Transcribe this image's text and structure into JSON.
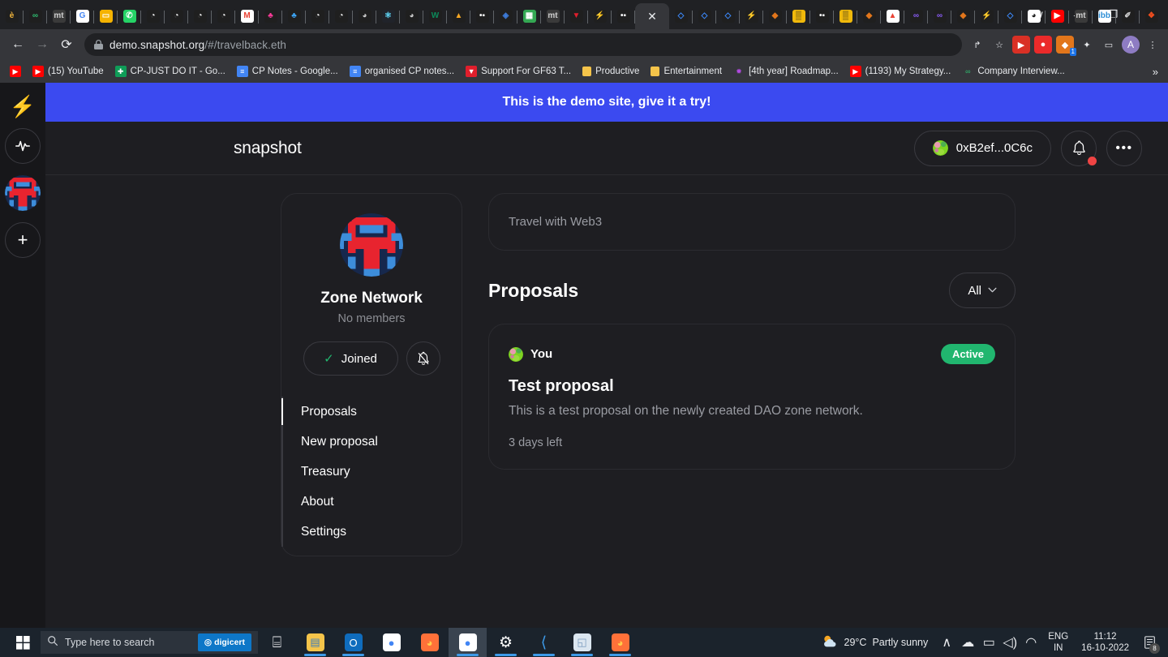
{
  "browser": {
    "tabs": [
      {
        "icon": "python-icon",
        "glyph": "è",
        "bg": "#1f1f1f",
        "fg": "#f5b83d"
      },
      {
        "icon": "link-icon",
        "glyph": "∞",
        "bg": "#1f1f1f",
        "fg": "#2fbf71"
      },
      {
        "icon": "mt-icon",
        "glyph": "mt",
        "bg": "#3a3a3a",
        "fg": "#d0d0d0"
      },
      {
        "icon": "google-icon",
        "glyph": "G",
        "bg": "#ffffff",
        "fg": "#4285f4"
      },
      {
        "icon": "note-icon",
        "glyph": "▭",
        "bg": "#f5b301",
        "fg": "#ffffff"
      },
      {
        "icon": "whatsapp-icon",
        "glyph": "✆",
        "bg": "#25d366",
        "fg": "#ffffff"
      },
      {
        "icon": "github-icon",
        "glyph": "◔",
        "bg": "#1f1f1f",
        "fg": "#ffffff"
      },
      {
        "icon": "github-icon",
        "glyph": "◔",
        "bg": "#1f1f1f",
        "fg": "#ffffff"
      },
      {
        "icon": "github-icon",
        "glyph": "◔",
        "bg": "#1f1f1f",
        "fg": "#ffffff"
      },
      {
        "icon": "github-icon",
        "glyph": "◔",
        "bg": "#1f1f1f",
        "fg": "#ffffff"
      },
      {
        "icon": "gmail-icon",
        "glyph": "M",
        "bg": "#ffffff",
        "fg": "#ea4335"
      },
      {
        "icon": "figma-icon",
        "glyph": "♣",
        "bg": "#1f1f1f",
        "fg": "#ff3b9a"
      },
      {
        "icon": "colorful-icon",
        "glyph": "♣",
        "bg": "#1f1f1f",
        "fg": "#3da5f5"
      },
      {
        "icon": "github-icon",
        "glyph": "◔",
        "bg": "#1f1f1f",
        "fg": "#ffffff"
      },
      {
        "icon": "github-icon",
        "glyph": "◔",
        "bg": "#1f1f1f",
        "fg": "#ffffff"
      },
      {
        "icon": "globe-icon",
        "glyph": "◕",
        "bg": "#1f1f1f",
        "fg": "#c6c6c6"
      },
      {
        "icon": "react-icon",
        "glyph": "⚛",
        "bg": "#20232a",
        "fg": "#61dafb"
      },
      {
        "icon": "globe-icon",
        "glyph": "◕",
        "bg": "#1f1f1f",
        "fg": "#c6c6c6"
      },
      {
        "icon": "w-icon",
        "glyph": "W",
        "bg": "#1f1f1f",
        "fg": "#0c8a5a"
      },
      {
        "icon": "tent-icon",
        "glyph": "▲",
        "bg": "#1f1f1f",
        "fg": "#f5a623"
      },
      {
        "icon": "dumbbell-icon",
        "glyph": "•▪",
        "bg": "#1f1f1f",
        "fg": "#ffffff"
      },
      {
        "icon": "eye-icon",
        "glyph": "◈",
        "bg": "#1f1f1f",
        "fg": "#3d7bd8"
      },
      {
        "icon": "sheet-icon",
        "glyph": "▦",
        "bg": "#34a853",
        "fg": "#ffffff"
      },
      {
        "icon": "mt-icon",
        "glyph": "mt",
        "bg": "#3a3a3a",
        "fg": "#d0d0d0"
      },
      {
        "icon": "tether-icon",
        "glyph": "▼",
        "bg": "#1f1f1f",
        "fg": "#e01e2c"
      },
      {
        "icon": "bolt-icon",
        "glyph": "⚡",
        "bg": "#1f1f1f",
        "fg": "#f5b301"
      },
      {
        "icon": "dumbbell-icon",
        "glyph": "•▪",
        "bg": "#1f1f1f",
        "fg": "#ffffff"
      },
      {
        "icon": "active-tab-close-icon",
        "glyph": "✕",
        "bg": "transparent",
        "fg": "#e8eaed",
        "active": true
      },
      {
        "icon": "diamond-icon",
        "glyph": "◇",
        "bg": "#1f1f1f",
        "fg": "#3d8bff"
      },
      {
        "icon": "diamond-icon",
        "glyph": "◇",
        "bg": "#1f1f1f",
        "fg": "#3d8bff"
      },
      {
        "icon": "diamond-icon",
        "glyph": "◇",
        "bg": "#1f1f1f",
        "fg": "#3d8bff"
      },
      {
        "icon": "bolt-icon",
        "glyph": "⚡",
        "bg": "#1f1f1f",
        "fg": "#f5b301"
      },
      {
        "icon": "metamask-icon",
        "glyph": "◆",
        "bg": "#1f1f1f",
        "fg": "#e2761b"
      },
      {
        "icon": "binance-icon",
        "glyph": "▒",
        "bg": "#f0b90b",
        "fg": "#1f1f1f"
      },
      {
        "icon": "dumbbell-icon",
        "glyph": "•▪",
        "bg": "#1f1f1f",
        "fg": "#ffffff"
      },
      {
        "icon": "binance-icon",
        "glyph": "▒",
        "bg": "#f0b90b",
        "fg": "#1f1f1f"
      },
      {
        "icon": "metamask-icon",
        "glyph": "◆",
        "bg": "#1f1f1f",
        "fg": "#e2761b"
      },
      {
        "icon": "photos-icon",
        "glyph": "▲",
        "bg": "#ffffff",
        "fg": "#ea4335"
      },
      {
        "icon": "chain-icon",
        "glyph": "∞",
        "bg": "#1f1f1f",
        "fg": "#8a5cf6"
      },
      {
        "icon": "chain-icon",
        "glyph": "∞",
        "bg": "#1f1f1f",
        "fg": "#8a5cf6"
      },
      {
        "icon": "metamask-icon",
        "glyph": "◆",
        "bg": "#1f1f1f",
        "fg": "#e2761b"
      },
      {
        "icon": "bolt-icon",
        "glyph": "⚡",
        "bg": "#1f1f1f",
        "fg": "#f5b301"
      },
      {
        "icon": "diamond-icon",
        "glyph": "◇",
        "bg": "#1f1f1f",
        "fg": "#3d8bff"
      },
      {
        "icon": "spiral-icon",
        "glyph": "◕",
        "bg": "#ffffff",
        "fg": "#1f1f1f"
      },
      {
        "icon": "youtube-icon",
        "glyph": "▶",
        "bg": "#ff0000",
        "fg": "#ffffff"
      },
      {
        "icon": "mt-icon",
        "glyph": "mt",
        "bg": "#3a3a3a",
        "fg": "#d0d0d0"
      },
      {
        "icon": "ibb-icon",
        "glyph": "ibb",
        "bg": "#ffffff",
        "fg": "#2f8fd6"
      },
      {
        "icon": "pen-icon",
        "glyph": "✐",
        "bg": "#1f1f1f",
        "fg": "#d0d0d0"
      },
      {
        "icon": "figma-icon",
        "glyph": "❖",
        "bg": "#1f1f1f",
        "fg": "#f24e1e"
      }
    ],
    "new_tab_label": "+",
    "window_controls": {
      "more": "∨",
      "minimize": "–",
      "maximize": "❐",
      "close": "✕"
    },
    "nav": {
      "back": "←",
      "forward": "→",
      "reload": "⟳"
    },
    "url": {
      "lock": "lock-icon",
      "host": "demo.snapshot.org",
      "path": "/#/travelback.eth"
    },
    "toolbar_icons": [
      {
        "name": "share-icon",
        "glyph": "↱",
        "bg": "transparent",
        "fg": "#e8eaed"
      },
      {
        "name": "bookmark-star-icon",
        "glyph": "☆",
        "bg": "transparent",
        "fg": "#e8eaed"
      },
      {
        "name": "extension-red-icon",
        "glyph": "▶",
        "bg": "#d93025",
        "fg": "#ffffff"
      },
      {
        "name": "extension-brave-icon",
        "glyph": "●",
        "bg": "#eb2a2a",
        "fg": "#ffffff"
      },
      {
        "name": "metamask-extension-icon",
        "glyph": "◆",
        "bg": "#e2761b",
        "fg": "#ffffff",
        "badge": "1"
      },
      {
        "name": "extensions-puzzle-icon",
        "glyph": "✦",
        "bg": "transparent",
        "fg": "#e8eaed"
      },
      {
        "name": "sidepanel-icon",
        "glyph": "▭",
        "bg": "transparent",
        "fg": "#e8eaed"
      },
      {
        "name": "profile-avatar-icon",
        "glyph": "A",
        "bg": "#8e7cc3",
        "fg": "#ffffff"
      },
      {
        "name": "chrome-menu-icon",
        "glyph": "⋮",
        "bg": "transparent",
        "fg": "#e8eaed"
      }
    ],
    "bookmarks": [
      {
        "label": "",
        "icon": "youtube-icon",
        "glyph": "▶",
        "bg": "#ff0000",
        "fg": "#ffffff"
      },
      {
        "label": "(15) YouTube",
        "icon": "youtube-icon",
        "glyph": "▶",
        "bg": "#ff0000",
        "fg": "#ffffff"
      },
      {
        "label": "CP-JUST DO IT - Go...",
        "icon": "sheets-icon",
        "glyph": "✚",
        "bg": "#0f9d58",
        "fg": "#ffffff"
      },
      {
        "label": "CP Notes - Google...",
        "icon": "docs-icon",
        "glyph": "≡",
        "bg": "#4285f4",
        "fg": "#ffffff"
      },
      {
        "label": "organised CP notes...",
        "icon": "docs-icon",
        "glyph": "≡",
        "bg": "#4285f4",
        "fg": "#ffffff"
      },
      {
        "label": "Support For GF63 T...",
        "icon": "msi-shield-icon",
        "glyph": "▼",
        "bg": "#e01e2c",
        "fg": "#ffffff"
      },
      {
        "label": "Productive",
        "icon": "folder-icon",
        "glyph": "▮",
        "bg": "#f5c44a",
        "fg": "#f5c44a"
      },
      {
        "label": "Entertainment",
        "icon": "folder-icon",
        "glyph": "▮",
        "bg": "#f5c44a",
        "fg": "#f5c44a"
      },
      {
        "label": "[4th year] Roadmap...",
        "icon": "roadmap-icon",
        "glyph": "✹",
        "bg": "transparent",
        "fg": "#b14ae0"
      },
      {
        "label": "(1193) My Strategy...",
        "icon": "youtube-icon",
        "glyph": "▶",
        "bg": "#ff0000",
        "fg": "#ffffff"
      },
      {
        "label": "Company Interview...",
        "icon": "link-icon",
        "glyph": "∞",
        "bg": "transparent",
        "fg": "#2fbf71"
      }
    ],
    "bookmarks_overflow": "»"
  },
  "rail": {
    "logo_icon": "snapshot-bolt-icon",
    "logo_glyph": "⚡",
    "items": [
      {
        "name": "activity-pulse-icon",
        "glyph": "∿"
      },
      {
        "name": "space-avatar-zone-network",
        "glyph": ""
      },
      {
        "name": "add-space-icon",
        "glyph": "+"
      }
    ]
  },
  "banner": {
    "text": "This is the demo site, give it a try!",
    "bg": "#3B4AF0"
  },
  "header": {
    "brand": "snapshot",
    "address": "0xB2ef...0C6c",
    "notifications_icon": "bell-icon",
    "has_notification_dot": true,
    "more_icon": "ellipsis-icon",
    "more_glyph": "•••"
  },
  "space": {
    "avatar_icon": "zone-network-avatar",
    "name": "Zone Network",
    "members": "No members",
    "joined_label": "Joined",
    "joined_check": "✓",
    "mute_icon": "bell-off-icon",
    "nav": [
      {
        "label": "Proposals",
        "active": true
      },
      {
        "label": "New proposal",
        "active": false
      },
      {
        "label": "Treasury",
        "active": false
      },
      {
        "label": "About",
        "active": false
      },
      {
        "label": "Settings",
        "active": false
      }
    ]
  },
  "content": {
    "about_text": "Travel with Web3",
    "proposals_title": "Proposals",
    "filter_label": "All",
    "filter_chevron": "⌄",
    "proposals": [
      {
        "author": "You",
        "author_avatar_icon": "user-jazzicon",
        "status": "Active",
        "status_color": "#21b66f",
        "title": "Test proposal",
        "description": "This is a test proposal on the newly created DAO zone network.",
        "time_left": "3 days left"
      }
    ]
  },
  "taskbar": {
    "start_icon": "windows-start-icon",
    "search_placeholder": "Type here to search",
    "search_icon": "magnifier-icon",
    "digicert_label": "digicert",
    "apps": [
      {
        "name": "task-view-icon",
        "glyph": "⌸",
        "bg": "transparent",
        "fg": "#e8eaed",
        "running": false,
        "active": false
      },
      {
        "name": "file-explorer-icon",
        "glyph": "▤",
        "bg": "#f5c44a",
        "fg": "#3a7bbf",
        "running": true,
        "active": false
      },
      {
        "name": "outlook-icon",
        "glyph": "O",
        "bg": "#0f6cbd",
        "fg": "#ffffff",
        "running": true,
        "active": false
      },
      {
        "name": "chrome-icon",
        "glyph": "●",
        "bg": "#ffffff",
        "fg": "#4285f4",
        "running": false,
        "active": false
      },
      {
        "name": "firefox-icon",
        "glyph": "◕",
        "bg": "#ff7139",
        "fg": "#ffd04a",
        "running": false,
        "active": false
      },
      {
        "name": "chrome-profile-icon",
        "glyph": "●",
        "bg": "#ffffff",
        "fg": "#4285f4",
        "running": true,
        "active": true
      },
      {
        "name": "settings-gear-icon",
        "glyph": "⚙",
        "bg": "transparent",
        "fg": "#ffffff",
        "running": true,
        "active": false
      },
      {
        "name": "vscode-icon",
        "glyph": "⟨",
        "bg": "transparent",
        "fg": "#3d9ae8",
        "running": true,
        "active": false
      },
      {
        "name": "sticky-notes-icon",
        "glyph": "◱",
        "bg": "#dbe6f0",
        "fg": "#7a9bbd",
        "running": true,
        "active": false
      },
      {
        "name": "firefox-profile-icon",
        "glyph": "◕",
        "bg": "#ff7139",
        "fg": "#ffd04a",
        "running": true,
        "active": false
      }
    ],
    "weather": {
      "icon": "partly-sunny-icon",
      "temp": "29°C",
      "desc": "Partly sunny"
    },
    "tray": [
      {
        "name": "show-hidden-icons-chevron",
        "glyph": "∧"
      },
      {
        "name": "onedrive-icon",
        "glyph": "☁"
      },
      {
        "name": "battery-icon",
        "glyph": "▭"
      },
      {
        "name": "volume-icon",
        "glyph": "◁)"
      },
      {
        "name": "wifi-icon",
        "glyph": "◠"
      }
    ],
    "language": {
      "line1": "ENG",
      "line2": "IN"
    },
    "clock": {
      "time": "11:12",
      "date": "16-10-2022"
    },
    "notification_center": {
      "icon": "notification-icon",
      "glyph": "☰",
      "count": "8"
    }
  }
}
